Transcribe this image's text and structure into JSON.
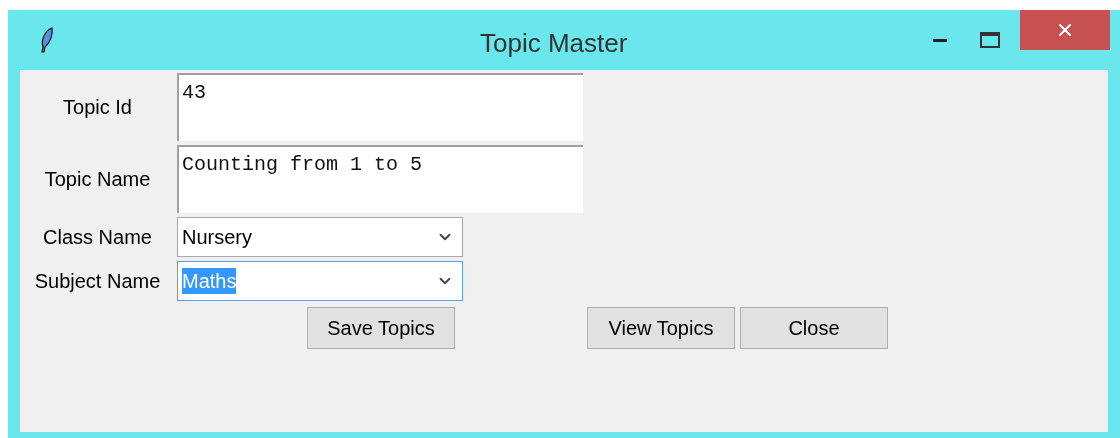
{
  "window": {
    "title": "Topic Master"
  },
  "fields": [
    {
      "kind": "text",
      "label": "Topic Id",
      "value": "43",
      "focused": false
    },
    {
      "kind": "text",
      "label": "Topic Name",
      "value": "Counting from 1 to 5",
      "focused": false
    },
    {
      "kind": "combo",
      "label": "Class Name",
      "value": "Nursery",
      "focused": false
    },
    {
      "kind": "combo",
      "label": "Subject Name",
      "value": "Maths",
      "focused": true
    }
  ],
  "buttons": [
    "Save Topics",
    "View Topics",
    "Close"
  ]
}
